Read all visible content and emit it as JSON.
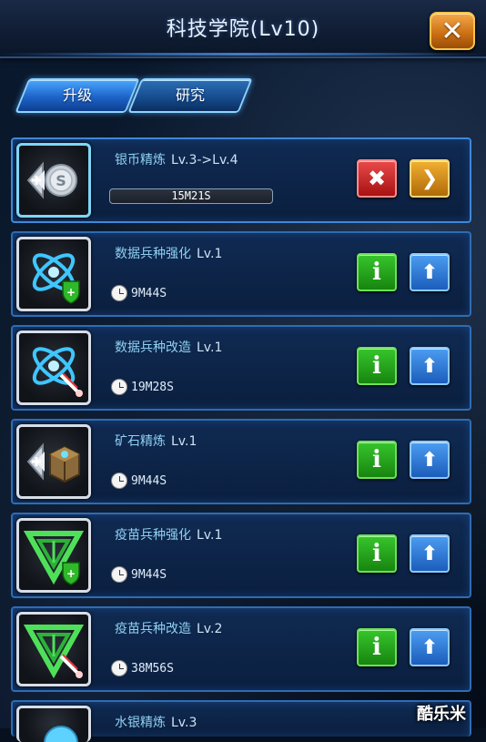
{
  "header": {
    "title": "科技学院(Lv10)",
    "close_label": "✕"
  },
  "tabs": [
    {
      "label": "升级",
      "active": true
    },
    {
      "label": "研究",
      "active": false
    }
  ],
  "research_items": [
    {
      "name": "银币精炼",
      "level": "Lv.3->Lv.4",
      "time": "15M21S",
      "icon": "silver-coin-refine-icon",
      "status": "in-progress",
      "progress": 0.0
    },
    {
      "name": "数据兵种强化",
      "level": "Lv.1",
      "time": "9M44S",
      "icon": "data-unit-enhance-icon",
      "status": "available"
    },
    {
      "name": "数据兵种改造",
      "level": "Lv.1",
      "time": "19M28S",
      "icon": "data-unit-modify-icon",
      "status": "available"
    },
    {
      "name": "矿石精炼",
      "level": "Lv.1",
      "time": "9M44S",
      "icon": "ore-refine-icon",
      "status": "available"
    },
    {
      "name": "疫苗兵种强化",
      "level": "Lv.1",
      "time": "9M44S",
      "icon": "vaccine-unit-enhance-icon",
      "status": "available"
    },
    {
      "name": "疫苗兵种改造",
      "level": "Lv.2",
      "time": "38M56S",
      "icon": "vaccine-unit-modify-icon",
      "status": "available"
    },
    {
      "name": "水银精炼",
      "level": "Lv.3",
      "icon": "mercury-refine-icon",
      "status": "partial"
    }
  ],
  "buttons": {
    "info_label": "i",
    "upgrade_label": "⬆",
    "cancel_label": "✖",
    "speedup_label": "❯"
  },
  "watermark": "酷乐米",
  "colors": {
    "accent": "#2e6cb4",
    "info": "#37c52c",
    "upgrade": "#4c9df1",
    "cancel": "#e94a4a",
    "speedup": "#f2b033",
    "close": "#f3a94a"
  }
}
